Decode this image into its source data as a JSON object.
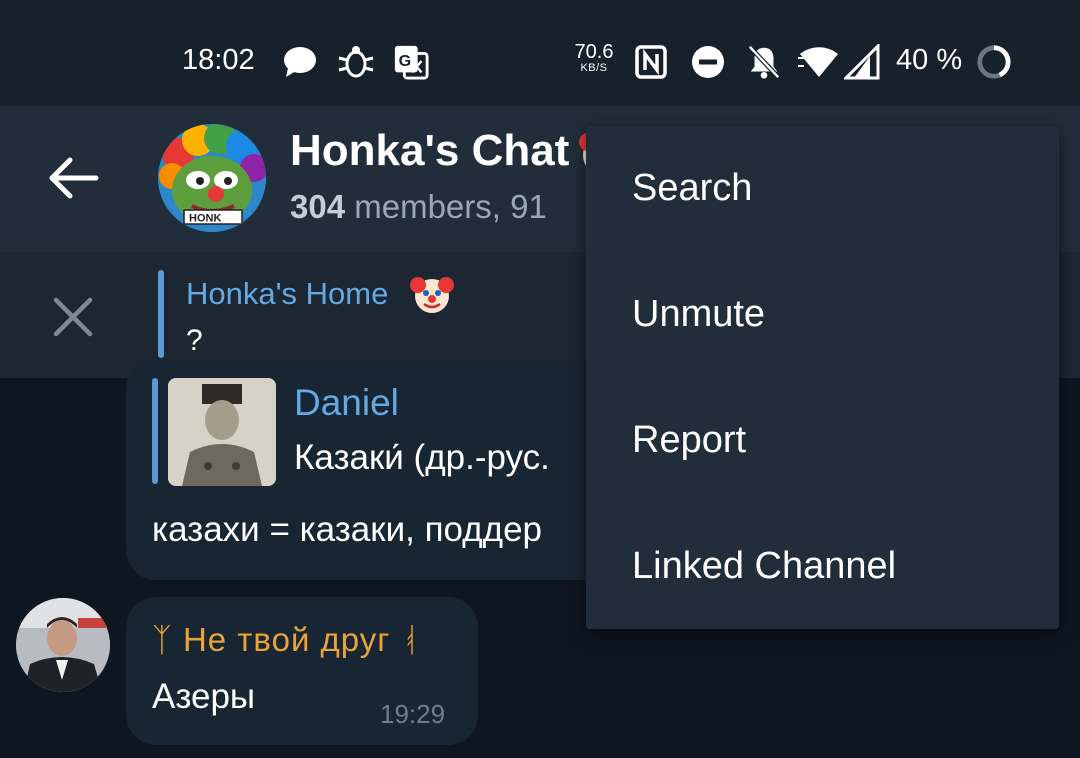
{
  "status_bar": {
    "time": "18:02",
    "net_speed_value": "70.6",
    "net_speed_unit": "KB/S",
    "battery": "40 %",
    "icons": [
      "chat-bubble-icon",
      "bug-icon",
      "translate-icon",
      "nfc-icon",
      "do-not-disturb-icon",
      "bell-off-icon",
      "wifi-icon",
      "signal-icon",
      "battery-ring-icon"
    ]
  },
  "header": {
    "title": "Honka's Chat",
    "subtitle_count": "304",
    "subtitle_rest": " members, 91",
    "avatar_label": "HONK"
  },
  "pinned": {
    "name": "Honka's Home",
    "text": "?"
  },
  "messages": [
    {
      "quote_name": "Daniel",
      "quote_text": "Казаки́ (др.-рус.",
      "text": "казахи = казаки, поддер"
    },
    {
      "sender": "ᛉ Не твой друг ᚮ",
      "text": "Азеры",
      "time": "19:29"
    }
  ],
  "menu": {
    "items": [
      "Search",
      "Unmute",
      "Report",
      "Linked Channel"
    ]
  },
  "colors": {
    "status_bar_bg": "#17212b",
    "header_bg": "#212d3b",
    "chat_bg": "#0e1621",
    "bubble_bg": "#182533",
    "accent_blue": "#64a8e4",
    "sender_orange": "#e8a33a"
  }
}
